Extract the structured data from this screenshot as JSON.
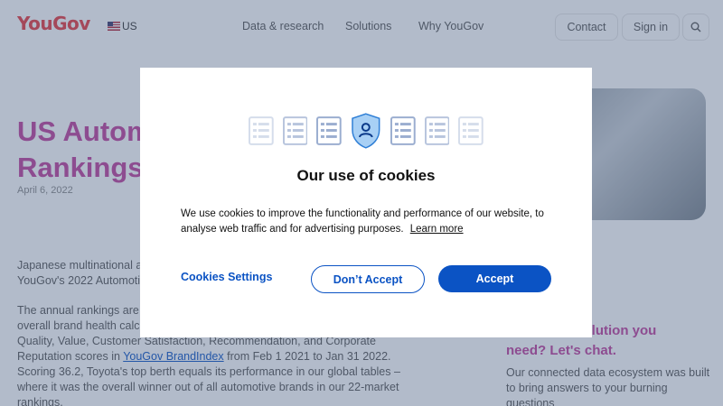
{
  "header": {
    "logo": "YouGov",
    "locale": "US",
    "nav": [
      "Data & research",
      "Solutions",
      "Why YouGov"
    ],
    "contact_label": "Contact",
    "signin_label": "Sign in"
  },
  "article": {
    "title_line1": "US Autom",
    "title_line2": "Rankings",
    "date": "April 6, 2022",
    "intro_line1": "Japanese multinational au",
    "intro_line2": "YouGov's 2022 Automotiv",
    "para_line1": "The annual rankings are d",
    "para_line2": "overall brand health calcu",
    "para_line3": "Quality, Value, Customer Satisfaction, Recommendation, and Corporate",
    "para_line4": "Reputation scores in",
    "para_link": "YouGov BrandIndex",
    "para_line4b": "from Feb 1 2021 to Jan 31 2022.",
    "para_line5": "Scoring 36.2, Toyota's top berth equals its performance in our global tables –",
    "para_line6": "where it was the overall winner out of all automotive brands in our 22-market",
    "para_line7": "rankings."
  },
  "sidebar": {
    "headline_line1": "t solution you",
    "headline_line2": "need? Let's chat.",
    "text_line1": "Our connected data ecosystem was built",
    "text_line2": "to bring answers to your burning",
    "text_line3": "questions"
  },
  "cookie_modal": {
    "title": "Our use of cookies",
    "text": "We use cookies to improve the functionality and performance of our website, to analyse web traffic and for advertising purposes.",
    "learn_more": "Learn more",
    "settings_label": "Cookies Settings",
    "reject_label": "Don’t Accept",
    "accept_label": "Accept"
  },
  "colors": {
    "brand_red": "#e7393f",
    "title_magenta": "#c0409c",
    "action_blue": "#0b53c4"
  }
}
